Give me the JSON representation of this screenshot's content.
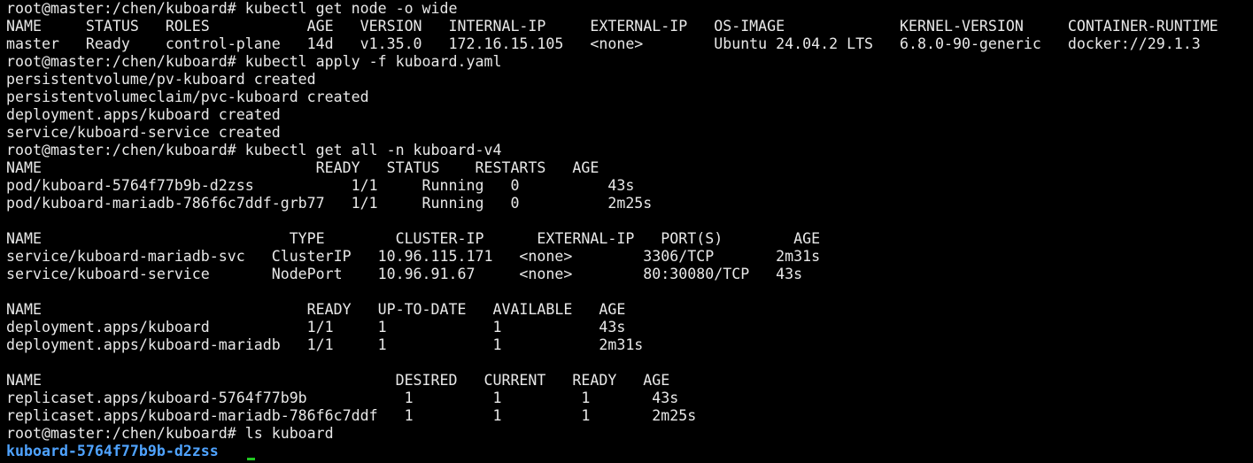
{
  "terminal": {
    "colors": {
      "background": "#000000",
      "foreground": "#e8e8e8",
      "highlight": "#4fa3ff",
      "cursor": "#21c821"
    },
    "lines": [
      "root@master:/chen/kuboard# kubectl get node -o wide",
      "NAME     STATUS   ROLES           AGE   VERSION   INTERNAL-IP     EXTERNAL-IP   OS-IMAGE             KERNEL-VERSION     CONTAINER-RUNTIME",
      "master   Ready    control-plane   14d   v1.35.0   172.16.15.105   <none>        Ubuntu 24.04.2 LTS   6.8.0-90-generic   docker://29.1.3",
      "root@master:/chen/kuboard# kubectl apply -f kuboard.yaml",
      "persistentvolume/pv-kuboard created",
      "persistentvolumeclaim/pvc-kuboard created",
      "deployment.apps/kuboard created",
      "service/kuboard-service created",
      "root@master:/chen/kuboard# kubectl get all -n kuboard-v4",
      "NAME                               READY   STATUS    RESTARTS   AGE",
      "pod/kuboard-5764f77b9b-d2zss           1/1     Running   0          43s",
      "pod/kuboard-mariadb-786f6c7ddf-grb77   1/1     Running   0          2m25s",
      "",
      "NAME                            TYPE        CLUSTER-IP      EXTERNAL-IP   PORT(S)        AGE",
      "service/kuboard-mariadb-svc   ClusterIP   10.96.115.171   <none>        3306/TCP       2m31s",
      "service/kuboard-service       NodePort    10.96.91.67     <none>        80:30080/TCP   43s",
      "",
      "NAME                              READY   UP-TO-DATE   AVAILABLE   AGE",
      "deployment.apps/kuboard           1/1     1            1           43s",
      "deployment.apps/kuboard-mariadb   1/1     1            1           2m31s",
      "",
      "NAME                                        DESIRED   CURRENT   READY   AGE",
      "replicaset.apps/kuboard-5764f77b9b           1         1         1       43s",
      "replicaset.apps/kuboard-mariadb-786f6c7ddf   1         1         1       2m25s",
      "root@master:/chen/kuboard# ls kuboard",
      "kuboard-5764f77b9b-d2zss"
    ]
  }
}
